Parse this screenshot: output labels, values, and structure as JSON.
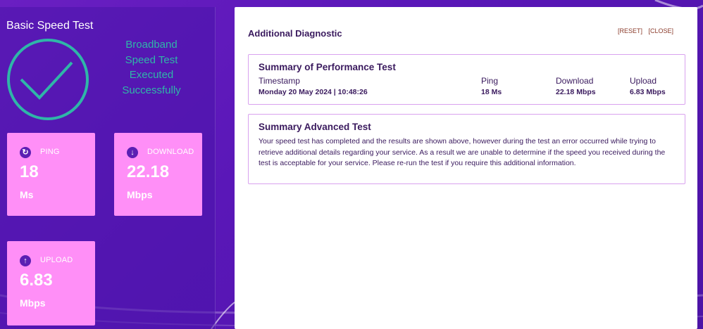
{
  "left": {
    "title": "Basic Speed Test",
    "result_lines": [
      "Broadband",
      "Speed Test",
      "Executed",
      "Successfully"
    ],
    "cards": {
      "ping": {
        "label": "PING",
        "value": "18",
        "unit": "Ms",
        "icon": "refresh-icon"
      },
      "download": {
        "label": "DOWNLOAD",
        "value": "22.18",
        "unit": "Mbps",
        "icon": "arrow-down-icon"
      },
      "upload": {
        "label": "UPLOAD",
        "value": "6.83",
        "unit": "Mbps",
        "icon": "arrow-up-icon"
      }
    }
  },
  "right": {
    "title": "Additional Diagnostic",
    "actions": {
      "reset": "[RESET]",
      "close": "[CLOSE]"
    },
    "performance": {
      "title": "Summary of Performance Test",
      "headers": {
        "timestamp": "Timestamp",
        "ping": "Ping",
        "download": "Download",
        "upload": "Upload"
      },
      "values": {
        "timestamp": "Monday 20 May 2024 | 10:48:26",
        "ping": "18 Ms",
        "download": "22.18 Mbps",
        "upload": "6.83 Mbps"
      }
    },
    "advanced": {
      "title": "Summary Advanced Test",
      "text": "Your speed test has completed and the results are shown above, however during the test an error occurred while trying to retrieve additional details regarding your service. As a result we are unable to determine if the speed you received during the test is acceptable for your service. Please re-run the test if you require this additional information."
    }
  },
  "colors": {
    "background": "#5a17b8",
    "card": "#ff8ff7",
    "success": "#2fb6a8",
    "border": "#d9a2ef",
    "text_dark": "#3a1a5e"
  }
}
